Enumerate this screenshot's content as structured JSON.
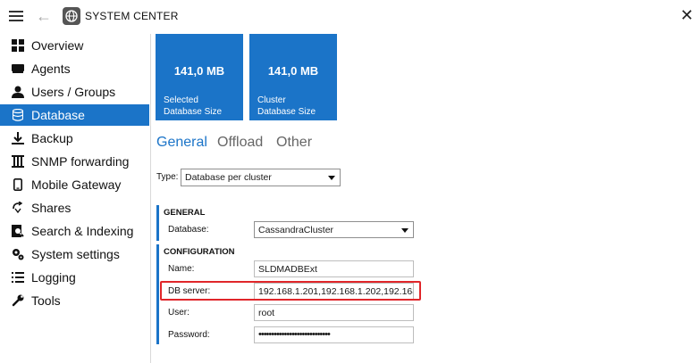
{
  "app": {
    "title": "SYSTEM CENTER"
  },
  "sidebar": {
    "items": [
      {
        "label": "Overview",
        "icon": "grid-icon",
        "active": false
      },
      {
        "label": "Agents",
        "icon": "agent-icon",
        "active": false
      },
      {
        "label": "Users / Groups",
        "icon": "user-icon",
        "active": false
      },
      {
        "label": "Database",
        "icon": "database-icon",
        "active": true
      },
      {
        "label": "Backup",
        "icon": "download-icon",
        "active": false
      },
      {
        "label": "SNMP forwarding",
        "icon": "snmp-icon",
        "active": false
      },
      {
        "label": "Mobile Gateway",
        "icon": "mobile-icon",
        "active": false
      },
      {
        "label": "Shares",
        "icon": "share-icon",
        "active": false
      },
      {
        "label": "Search & Indexing",
        "icon": "search-index-icon",
        "active": false
      },
      {
        "label": "System settings",
        "icon": "settings-icon",
        "active": false
      },
      {
        "label": "Logging",
        "icon": "list-icon",
        "active": false
      },
      {
        "label": "Tools",
        "icon": "wrench-icon",
        "active": false
      }
    ]
  },
  "tiles": [
    {
      "value": "141,0 MB",
      "caption_line1": "Selected",
      "caption_line2": "Database Size"
    },
    {
      "value": "141,0 MB",
      "caption_line1": "Cluster",
      "caption_line2": "Database Size"
    }
  ],
  "tabs": [
    {
      "label": "General",
      "active": true
    },
    {
      "label": "Offload",
      "active": false
    },
    {
      "label": "Other",
      "active": false
    }
  ],
  "type": {
    "label": "Type:",
    "value": "Database per cluster"
  },
  "general": {
    "title": "GENERAL",
    "database_label": "Database:",
    "database_value": "CassandraCluster"
  },
  "configuration": {
    "title": "CONFIGURATION",
    "name_label": "Name:",
    "name_value": "SLDMADBExt",
    "db_server_label": "DB server:",
    "db_server_value": "192.168.1.201,192.168.1.202,192.168.1",
    "user_label": "User:",
    "user_value": "root",
    "password_label": "Password:",
    "password_value": "••••••••••••••••••••••••••••"
  },
  "colors": {
    "accent": "#1b74c8",
    "highlight": "#e0262a"
  }
}
